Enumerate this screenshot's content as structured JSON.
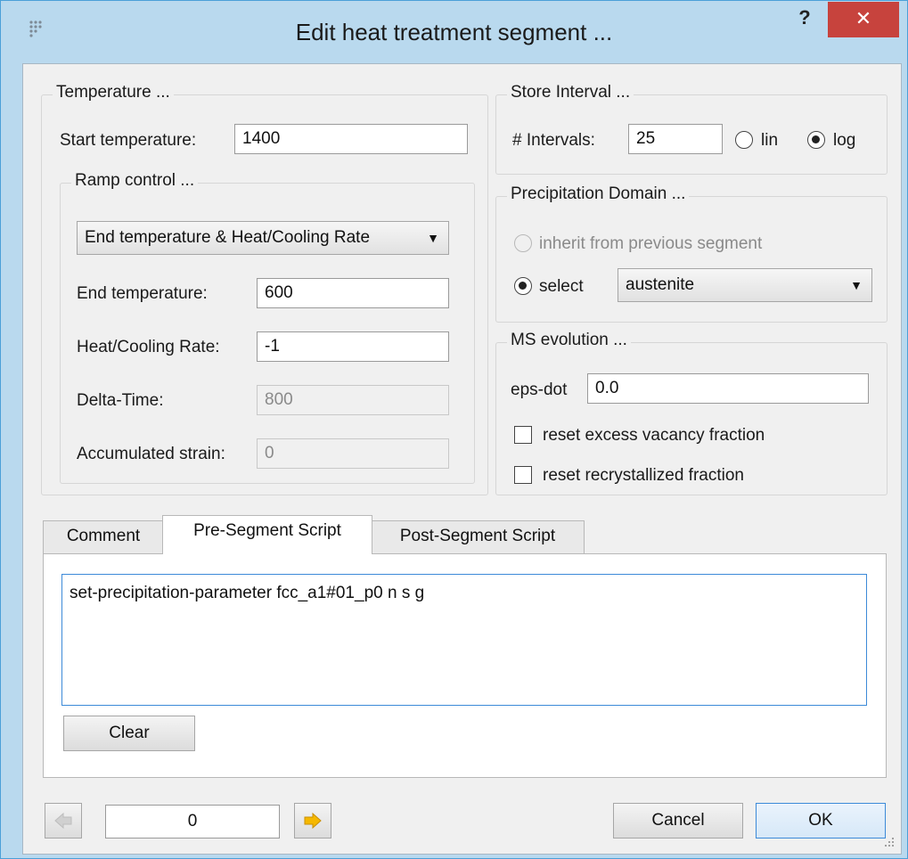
{
  "window": {
    "title": "Edit heat treatment segment ...",
    "help_label": "?",
    "close_label": "✕"
  },
  "temperature": {
    "group_title": "Temperature ...",
    "start_label": "Start temperature:",
    "start_value": "1400",
    "ramp": {
      "group_title": "Ramp control ...",
      "mode_value": "End temperature & Heat/Cooling Rate",
      "end_label": "End temperature:",
      "end_value": "600",
      "rate_label": "Heat/Cooling Rate:",
      "rate_value": "-1",
      "delta_label": "Delta-Time:",
      "delta_value": "800",
      "strain_label": "Accumulated strain:",
      "strain_value": "0"
    }
  },
  "store_interval": {
    "group_title": "Store Interval ...",
    "intervals_label": "# Intervals:",
    "intervals_value": "25",
    "lin_label": "lin",
    "log_label": "log",
    "selected": "log"
  },
  "precipitation": {
    "group_title": "Precipitation Domain ...",
    "inherit_label": "inherit from previous segment",
    "select_label": "select",
    "domain_value": "austenite",
    "selected": "select"
  },
  "ms_evolution": {
    "group_title": "MS evolution ...",
    "epsdot_label": "eps-dot",
    "epsdot_value": "0.0",
    "reset_vacancy_label": "reset excess vacancy fraction",
    "reset_vacancy_checked": false,
    "reset_recryst_label": "reset recrystallized fraction",
    "reset_recryst_checked": false
  },
  "tabs": [
    {
      "label": "Comment",
      "active": false
    },
    {
      "label": "Pre-Segment Script",
      "active": true
    },
    {
      "label": "Post-Segment Script",
      "active": false
    }
  ],
  "script": {
    "text": "set-precipitation-parameter fcc_a1#01_p0 n s g",
    "clear_label": "Clear"
  },
  "footer": {
    "segment_index": "0",
    "cancel_label": "Cancel",
    "ok_label": "OK"
  },
  "colors": {
    "accent": "#3c8ad8",
    "close": "#c7433d",
    "frame": "#b9d9ee",
    "arrow": "#f5b800"
  }
}
